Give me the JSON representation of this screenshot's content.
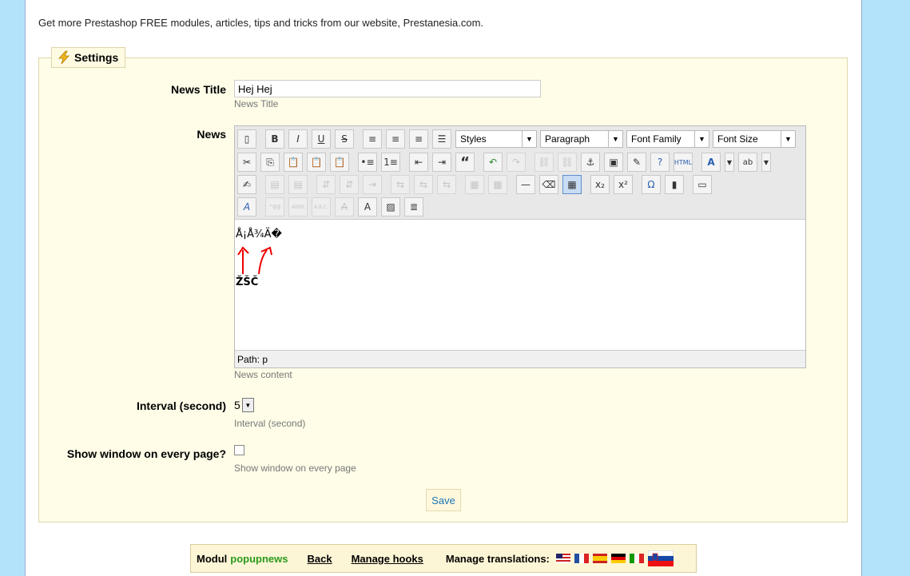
{
  "promo_text": "Get more Prestashop FREE modules, articles, tips and tricks from our website, Prestanesia.com.",
  "settings": {
    "legend": "Settings",
    "news_title": {
      "label": "News Title",
      "value": "Hej Hej",
      "hint": "News Title"
    },
    "news": {
      "label": "News",
      "hint": "News content",
      "dropdowns": [
        "Styles",
        "Paragraph",
        "Font Family",
        "Font Size"
      ],
      "content_line1": "Å¡Å¾Ä�",
      "content_line2": "ŽŠČ",
      "status_path": "Path: p"
    },
    "interval": {
      "label": "Interval (second)",
      "value": "5",
      "hint": "Interval (second)"
    },
    "show_window": {
      "label": "Show window on every page?",
      "hint": "Show window on every page",
      "checked": false
    },
    "save_label": "Save"
  },
  "footer": {
    "modul_label": "Modul",
    "module_name": "popupnews",
    "back_label": "Back",
    "manage_hooks_label": "Manage hooks",
    "manage_translations_label": "Manage translations:"
  },
  "colors": {
    "page_bg": "#b3e3fb",
    "fieldset_bg": "#fffde8",
    "module_name": "#2a9a1a",
    "save_text": "#1a74b8"
  }
}
